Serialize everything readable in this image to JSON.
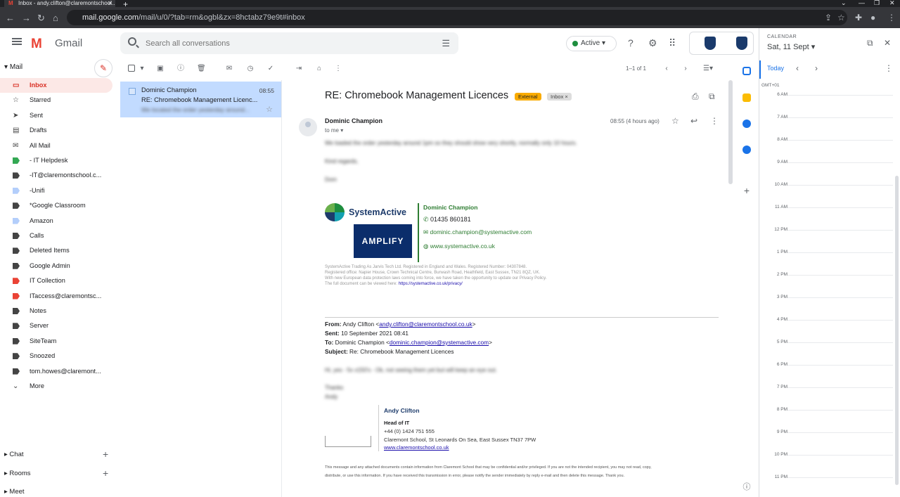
{
  "browser": {
    "tab_title": "Inbox - andy.clifton@claremontschool...",
    "url_domain": "mail.google.com",
    "url_path": "/mail/u/0/?tab=rm&ogbl&zx=8hctabz79e9t#inbox"
  },
  "header": {
    "app_name": "Gmail",
    "search_placeholder": "Search all conversations",
    "status": "Active"
  },
  "sidebar": {
    "mail_label": "Mail",
    "items": [
      {
        "label": "Inbox",
        "icon": "inbox-icon",
        "selected": true
      },
      {
        "label": "Starred",
        "icon": "star-icon"
      },
      {
        "label": "Sent",
        "icon": "send-icon"
      },
      {
        "label": "Drafts",
        "icon": "draft-icon"
      },
      {
        "label": "All Mail",
        "icon": "mail-icon"
      },
      {
        "label": "- IT Helpdesk",
        "color": "#33a853"
      },
      {
        "label": "-IT@claremontschool.c...",
        "color": "#444444"
      },
      {
        "label": "-Unifi",
        "color": "#b3cefb"
      },
      {
        "label": "*Google Classroom",
        "color": "#444444"
      },
      {
        "label": "Amazon",
        "color": "#b3cefb"
      },
      {
        "label": "Calls",
        "color": "#444444"
      },
      {
        "label": "Deleted Items",
        "color": "#444444"
      },
      {
        "label": "Google Admin",
        "color": "#444444"
      },
      {
        "label": "IT Collection",
        "color": "#ea4335"
      },
      {
        "label": "ITaccess@claremontsc...",
        "color": "#ea4335"
      },
      {
        "label": "Notes",
        "color": "#444444"
      },
      {
        "label": "Server",
        "color": "#444444"
      },
      {
        "label": "SiteTeam",
        "color": "#444444"
      },
      {
        "label": "Snoozed",
        "color": "#444444"
      },
      {
        "label": "tom.howes@claremont...",
        "color": "#444444"
      },
      {
        "label": "More",
        "icon": "chevron-down-icon"
      }
    ],
    "chat": "Chat",
    "rooms": "Rooms",
    "meet": "Meet"
  },
  "toolbar": {
    "pager": "1–1 of 1"
  },
  "list": {
    "from": "Dominic Champion",
    "time": "08:55",
    "subject": "RE: Chromebook Management Licenc...",
    "snippet": "We located the order yesterday around..."
  },
  "email": {
    "subject": "RE: Chromebook Management Licences",
    "badge_external": "External",
    "badge_inbox": "Inbox ×",
    "sender": "Dominic Champion",
    "to": "to me ▾",
    "time": "08:55 (4 hours ago)",
    "body_line1": "We loaded the order yesterday around 1pm so they should show very shortly, normally only 10 hours.",
    "body_line2": "Kind regards,",
    "body_line3": "Dom",
    "logo_text": "SystemActive",
    "amplify": "AMPLIFY",
    "sig_name": "Dominic Champion",
    "sig_phone": "01435 860181",
    "sig_email": "dominic.champion@systemactive.com",
    "sig_web": "www.systemactive.co.uk",
    "legal1": "SystemActive Trading As Jarvis Tech Ltd. Registered in England and Wales. Registered Number: 04307848.",
    "legal2": "Registered office: Napier House, Crown Technical Centre, Burwash Road, Heathfield, East Sussex, TN21 8QZ, UK.",
    "legal3": "With new European data protection laws coming into force, we have taken the opportunity to update our Privacy Policy.",
    "legal4": "The full document can be viewed here:",
    "legal_link": "https://systemactive.co.uk/privacy/",
    "fw_from_label": "From:",
    "fw_from": "Andy Clifton <",
    "fw_from_email": "andy.clifton@claremontschool.co.uk",
    "fw_from_end": ">",
    "fw_sent_label": "Sent:",
    "fw_sent": "10 September 2021 08:41",
    "fw_to_label": "To:",
    "fw_to": "Dominic Champion <",
    "fw_to_email": "dominic.champion@systemactive.com",
    "fw_to_end": ">",
    "fw_subj_label": "Subject:",
    "fw_subj": "Re: Chromebook Management Licences",
    "fw_body1": "Hi, yes - 5x x150's - Ok, not seeing them yet but will keep an eye out.",
    "fw_body2": "Thanks",
    "fw_body3": "Andy",
    "ac_name": "Andy Clifton",
    "ac_title": "Head of IT",
    "ac_phone": "+44 (0) 1424 751 555",
    "ac_addr": "Claremont School, St Leonards On Sea, East Sussex TN37 7PW",
    "ac_web": "www.claremontschool.co.uk",
    "disclaimer1": "This message and any attached documents contain information from Claremont School that may be confidential and/or privileged. If you are not the intended recipient, you may not read, copy,",
    "disclaimer2": "distribute, or use this information. If you have received this transmission in error, please notify the sender immediately by reply e-mail and then delete this message. Thank you."
  },
  "calendar": {
    "header": "CALENDAR",
    "date": "Sat, 11 Sept ▾",
    "today": "Today",
    "tz": "GMT+01",
    "hours": [
      "6 AM",
      "7 AM",
      "8 AM",
      "9 AM",
      "10 AM",
      "11 AM",
      "12 PM",
      "1 PM",
      "2 PM",
      "3 PM",
      "4 PM",
      "5 PM",
      "6 PM",
      "7 PM",
      "8 PM",
      "9 PM",
      "10 PM",
      "11 PM"
    ]
  }
}
